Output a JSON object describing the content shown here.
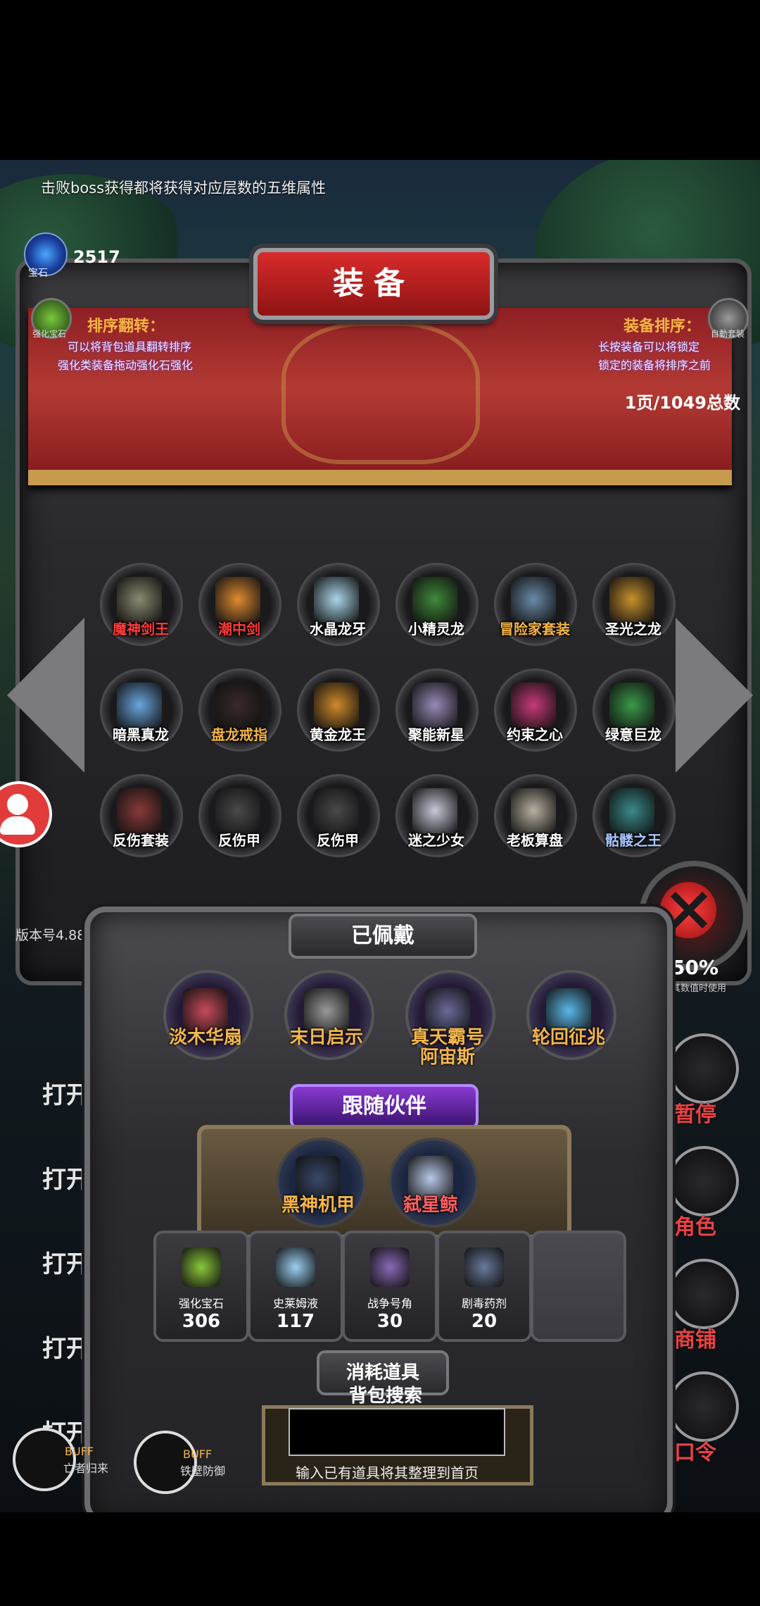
{
  "hint": "击败boss获得都将获得对应层数的五维属性",
  "gem": {
    "label": "宝石",
    "count": "2517"
  },
  "title": "装备",
  "left_badge_label": "强化宝石",
  "right_badge_label": "自動套裝",
  "sort_flip": {
    "title": "排序翻转：",
    "line1": "可以将背包道具翻转排序",
    "line2": "强化类装备拖动强化石强化"
  },
  "equip_sort": {
    "title": "装备排序：",
    "line1": "长按装备可以将锁定",
    "line2": "锁定的装备将排序之前"
  },
  "page_count": "1页/1049总数",
  "grid": [
    {
      "label": "魔神剑王",
      "color": "#ff3b3b",
      "art": "#8a8a70"
    },
    {
      "label": "潮中剑",
      "color": "#ff3b3b",
      "art": "#e08a30"
    },
    {
      "label": "水晶龙牙",
      "color": "#ffffff",
      "art": "#a9d6e8"
    },
    {
      "label": "小精灵龙",
      "color": "#ffffff",
      "art": "#3f8a3a"
    },
    {
      "label": "冒险家套装",
      "color": "#f6b546",
      "art": "#6a8aa8"
    },
    {
      "label": "圣光之龙",
      "color": "#ffffff",
      "art": "#c8902c"
    },
    {
      "label": "暗黑真龙",
      "color": "#ffffff",
      "art": "#6aa6e0"
    },
    {
      "label": "盘龙戒指",
      "color": "#f6b546",
      "art": "#3a2a2a"
    },
    {
      "label": "黄金龙王",
      "color": "#ffffff",
      "art": "#d08a2a"
    },
    {
      "label": "聚能新星",
      "color": "#ffffff",
      "art": "#9a8ab8"
    },
    {
      "label": "约束之心",
      "color": "#ffffff",
      "art": "#c83a78"
    },
    {
      "label": "绿意巨龙",
      "color": "#ffffff",
      "art": "#3a9a4a"
    },
    {
      "label": "反伤套装",
      "color": "#ffffff",
      "art": "#8a3a3a"
    },
    {
      "label": "反伤甲",
      "color": "#ffffff",
      "art": "#4a4a4a"
    },
    {
      "label": "反伤甲",
      "color": "#ffffff",
      "art": "#4a4a4a"
    },
    {
      "label": "迷之少女",
      "color": "#ffffff",
      "art": "#c8c8d8"
    },
    {
      "label": "老板算盘",
      "color": "#ffffff",
      "art": "#b8b0a0"
    },
    {
      "label": "骷髅之王",
      "color": "#a8c8ff",
      "art": "#3a8a8a"
    }
  ],
  "version": "版本号4.88",
  "equipped": {
    "title": "已佩戴",
    "items": [
      {
        "label": "淡木华扇",
        "art": "#c84a5a"
      },
      {
        "label": "末日启示",
        "art": "#9a9a9a"
      },
      {
        "label": "真天霸号\n阿宙斯",
        "art": "#6a6a9a"
      },
      {
        "label": "轮回征兆",
        "art": "#5ab8e8"
      }
    ]
  },
  "companion": {
    "title": "跟随伙伴",
    "items": [
      {
        "label": "黑神机甲",
        "art": "#3a4a6a"
      },
      {
        "label": "弑星鲸",
        "art": "#b8c8e8"
      }
    ]
  },
  "consumables": {
    "title": "消耗道具",
    "items": [
      {
        "name": "强化宝石",
        "count": "306",
        "art": "#8ac83a"
      },
      {
        "name": "史莱姆液",
        "count": "117",
        "art": "#9ad0f0"
      },
      {
        "name": "战争号角",
        "count": "30",
        "art": "#8a6ab8"
      },
      {
        "name": "剧毒药剂",
        "count": "20",
        "art": "#6a7a9a"
      }
    ]
  },
  "search": {
    "title": "背包搜索",
    "hint": "输入已有道具将其整理到首页",
    "placeholder": ""
  },
  "right_col": {
    "partial_value": "50%",
    "partial_note": "其数值时使用",
    "pause": "暂停",
    "role": "角色",
    "shop": "商铺",
    "code": "口令"
  },
  "logs": [
    "打开",
    "打开了",
    "打开",
    "打开",
    "打开了精致的宝箱"
  ],
  "buffs": [
    {
      "tag": "BUFF",
      "name": "亡者归来"
    },
    {
      "tag": "BUFF",
      "name": "铁壁防御"
    }
  ]
}
